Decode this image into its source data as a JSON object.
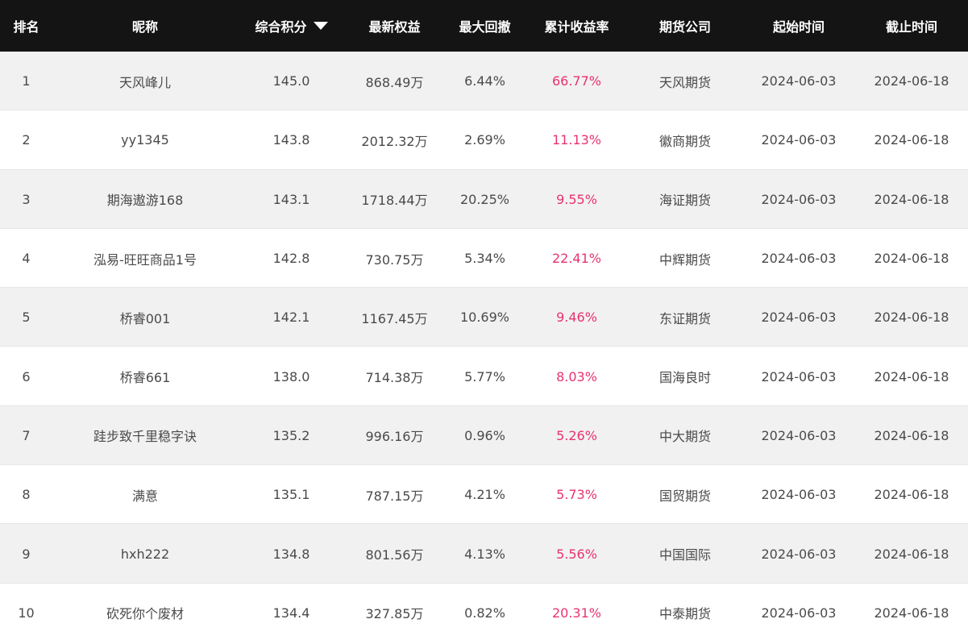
{
  "header": {
    "rank": "排名",
    "nickname": "昵称",
    "score": "综合积分",
    "equity": "最新权益",
    "drawdown": "最大回撤",
    "return": "累计收益率",
    "company": "期货公司",
    "start": "起始时间",
    "end": "截止时间",
    "sort_icon": "caret-down-icon"
  },
  "colors": {
    "header_bg": "#141414",
    "row_odd": "#f1f1f1",
    "row_even": "#ffffff",
    "return_text": "#e8336e"
  },
  "rows": [
    {
      "rank": "1",
      "nickname": "天风峰儿",
      "score": "145.0",
      "equity": "868.49万",
      "drawdown": "6.44%",
      "return": "66.77%",
      "company": "天风期货",
      "start": "2024-06-03",
      "end": "2024-06-18"
    },
    {
      "rank": "2",
      "nickname": "yy1345",
      "score": "143.8",
      "equity": "2012.32万",
      "drawdown": "2.69%",
      "return": "11.13%",
      "company": "徽商期货",
      "start": "2024-06-03",
      "end": "2024-06-18"
    },
    {
      "rank": "3",
      "nickname": "期海遨游168",
      "score": "143.1",
      "equity": "1718.44万",
      "drawdown": "20.25%",
      "return": "9.55%",
      "company": "海证期货",
      "start": "2024-06-03",
      "end": "2024-06-18"
    },
    {
      "rank": "4",
      "nickname": "泓易-旺旺商品1号",
      "score": "142.8",
      "equity": "730.75万",
      "drawdown": "5.34%",
      "return": "22.41%",
      "company": "中辉期货",
      "start": "2024-06-03",
      "end": "2024-06-18"
    },
    {
      "rank": "5",
      "nickname": "桥睿001",
      "score": "142.1",
      "equity": "1167.45万",
      "drawdown": "10.69%",
      "return": "9.46%",
      "company": "东证期货",
      "start": "2024-06-03",
      "end": "2024-06-18"
    },
    {
      "rank": "6",
      "nickname": "桥睿661",
      "score": "138.0",
      "equity": "714.38万",
      "drawdown": "5.77%",
      "return": "8.03%",
      "company": "国海良时",
      "start": "2024-06-03",
      "end": "2024-06-18"
    },
    {
      "rank": "7",
      "nickname": "跬步致千里稳字诀",
      "score": "135.2",
      "equity": "996.16万",
      "drawdown": "0.96%",
      "return": "5.26%",
      "company": "中大期货",
      "start": "2024-06-03",
      "end": "2024-06-18"
    },
    {
      "rank": "8",
      "nickname": "满意",
      "score": "135.1",
      "equity": "787.15万",
      "drawdown": "4.21%",
      "return": "5.73%",
      "company": "国贸期货",
      "start": "2024-06-03",
      "end": "2024-06-18"
    },
    {
      "rank": "9",
      "nickname": "hxh222",
      "score": "134.8",
      "equity": "801.56万",
      "drawdown": "4.13%",
      "return": "5.56%",
      "company": "中国国际",
      "start": "2024-06-03",
      "end": "2024-06-18"
    },
    {
      "rank": "10",
      "nickname": "砍死你个废材",
      "score": "134.4",
      "equity": "327.85万",
      "drawdown": "0.82%",
      "return": "20.31%",
      "company": "中泰期货",
      "start": "2024-06-03",
      "end": "2024-06-18"
    }
  ]
}
